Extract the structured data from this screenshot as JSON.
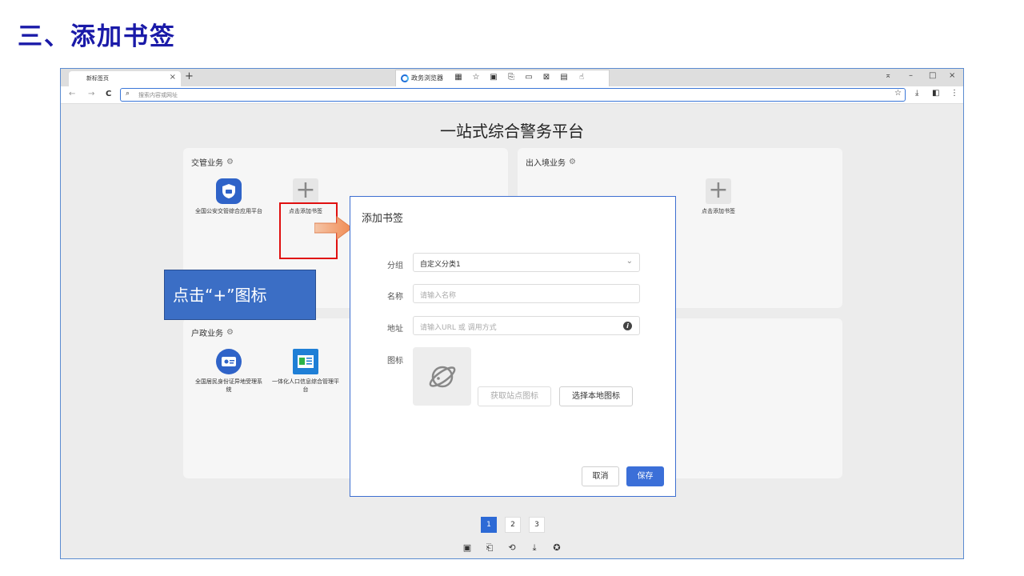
{
  "slide": {
    "title": "三、添加书签"
  },
  "browser": {
    "tab_title": "新标签页",
    "tab_close": "×",
    "new_tab": "+",
    "ext_brand": "政务浏览器",
    "ext_icons": [
      "▦",
      "☆",
      "▣",
      "⎘",
      "▭",
      "⊠",
      "▤",
      "☝"
    ],
    "window_controls": [
      "⌅",
      "–",
      "□",
      "×"
    ],
    "nav": [
      "←",
      "→",
      "C"
    ],
    "address_icon": "⌕",
    "address_placeholder": "搜索内容或网址",
    "addr_right": [
      "☆",
      "⤓",
      "◧",
      "⋮"
    ]
  },
  "page": {
    "heading": "一站式综合警务平台",
    "cards": [
      {
        "title": "交管业务",
        "apps": [
          {
            "label": "全国公安交管综合应用平台"
          },
          {
            "label": "点击添加书签"
          }
        ]
      },
      {
        "title": "出入境业务",
        "apps": [
          {
            "label": "点击添加书签"
          }
        ]
      },
      {
        "title": "户政业务",
        "apps": [
          {
            "label": "全国居民身份证异地受理系统"
          },
          {
            "label": "一体化人口信息综合管理平台"
          }
        ]
      }
    ],
    "pager": [
      "1",
      "2",
      "3"
    ],
    "active_page": "1",
    "bottom_icons": [
      "▣",
      "⎗",
      "⟲",
      "⤓",
      "✪"
    ]
  },
  "callout": {
    "text": "点击“+”图标"
  },
  "dialog": {
    "title": "添加书签",
    "group_label": "分组",
    "group_value": "自定义分类1",
    "name_label": "名称",
    "name_placeholder": "请输入名称",
    "address_label": "地址",
    "address_placeholder": "请输入URL 或 调用方式",
    "icon_label": "图标",
    "fetch_icon_button": "获取站点图标",
    "local_icon_button": "选择本地图标",
    "cancel_button": "取消",
    "save_button": "保存"
  },
  "colors": {
    "accent": "#3b6fd8",
    "highlight": "#e01010",
    "callout": "#3b6ec5",
    "title": "#1a1aa8"
  }
}
